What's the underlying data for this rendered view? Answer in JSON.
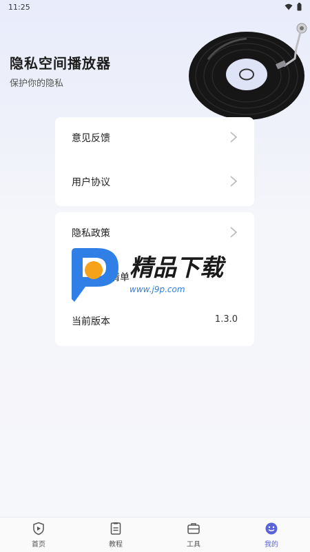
{
  "status_bar": {
    "time": "11:25"
  },
  "header": {
    "title": "隐私空间播放器",
    "subtitle": "保护你的隐私"
  },
  "menu": {
    "group1": [
      {
        "label": "意见反馈"
      },
      {
        "label": "用户协议"
      }
    ],
    "group2": [
      {
        "label": "隐私政策"
      },
      {
        "label": "个人信息清单"
      },
      {
        "label": "当前版本",
        "value": "1.3.0"
      }
    ]
  },
  "watermark": {
    "brand": "精品下载",
    "url": "www.j9p.com"
  },
  "tabs": [
    {
      "label": "首页",
      "icon": "shield-play-icon"
    },
    {
      "label": "教程",
      "icon": "document-icon"
    },
    {
      "label": "工具",
      "icon": "toolbox-icon"
    },
    {
      "label": "我的",
      "icon": "smile-icon",
      "active": true
    }
  ],
  "colors": {
    "accent": "#5b63d8",
    "card": "#ffffff",
    "watermark_blue": "#2f7fe6",
    "watermark_orange": "#f7a21b"
  }
}
